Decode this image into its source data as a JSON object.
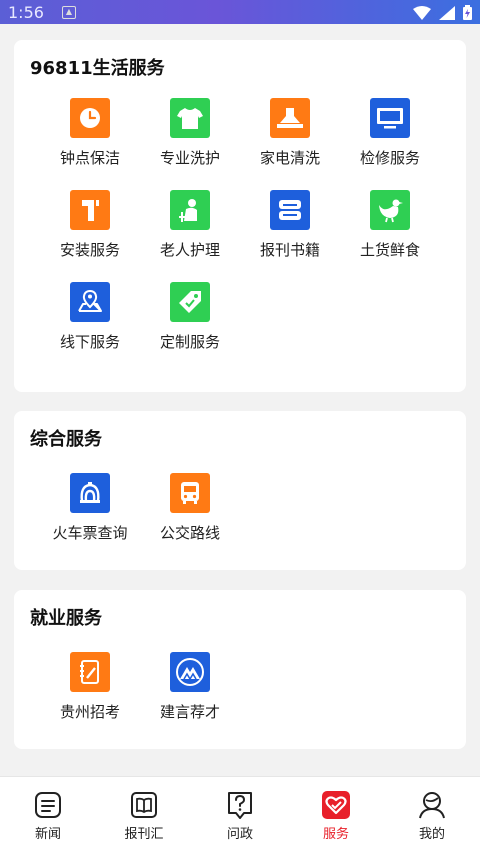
{
  "status_bar": {
    "time": "1:56"
  },
  "colors": {
    "orange": "#ff7a14",
    "green": "#2fcf53",
    "blue": "#1e5fdc",
    "active_red": "#e8202a"
  },
  "sections": {
    "life": {
      "title": "96811生活服务",
      "items": [
        {
          "label": "钟点保洁",
          "icon": "clock-icon",
          "color": "orange"
        },
        {
          "label": "专业洗护",
          "icon": "tshirt-icon",
          "color": "green"
        },
        {
          "label": "家电清洗",
          "icon": "range-hood-icon",
          "color": "orange"
        },
        {
          "label": "检修服务",
          "icon": "monitor-icon",
          "color": "blue"
        },
        {
          "label": "安装服务",
          "icon": "install-icon",
          "color": "orange"
        },
        {
          "label": "老人护理",
          "icon": "elderly-icon",
          "color": "green"
        },
        {
          "label": "报刊书籍",
          "icon": "book-icon",
          "color": "blue"
        },
        {
          "label": "土货鲜食",
          "icon": "chicken-icon",
          "color": "green"
        },
        {
          "label": "线下服务",
          "icon": "map-pin-icon",
          "color": "blue"
        },
        {
          "label": "定制服务",
          "icon": "tag-icon",
          "color": "green"
        }
      ]
    },
    "general": {
      "title": "综合服务",
      "items": [
        {
          "label": "火车票查询",
          "icon": "train-icon",
          "color": "blue"
        },
        {
          "label": "公交路线",
          "icon": "bus-icon",
          "color": "orange"
        }
      ]
    },
    "jobs": {
      "title": "就业服务",
      "items": [
        {
          "label": "贵州招考",
          "icon": "notebook-icon",
          "color": "orange"
        },
        {
          "label": "建言荐才",
          "icon": "mountain-icon",
          "color": "blue"
        }
      ]
    }
  },
  "bottom_nav": {
    "items": [
      {
        "label": "新闻",
        "icon": "news-icon",
        "active": false
      },
      {
        "label": "报刊汇",
        "icon": "newspaper-book-icon",
        "active": false
      },
      {
        "label": "问政",
        "icon": "question-icon",
        "active": false
      },
      {
        "label": "服务",
        "icon": "heart-service-icon",
        "active": true
      },
      {
        "label": "我的",
        "icon": "profile-icon",
        "active": false
      }
    ]
  }
}
